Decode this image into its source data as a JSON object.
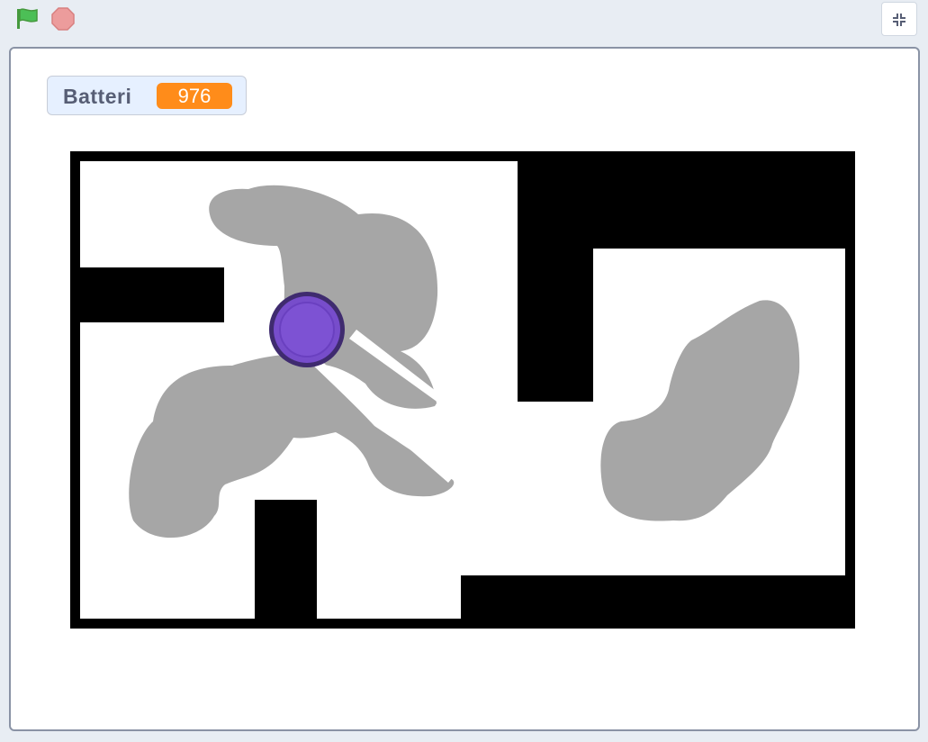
{
  "controls": {
    "green_flag_icon": "green-flag-icon",
    "stop_icon": "stop-sign-icon",
    "unfullscreen_icon": "unfullscreen-icon"
  },
  "monitor": {
    "label": "Batteri",
    "value": "976"
  },
  "colors": {
    "wall": "#000000",
    "floor": "#ffffff",
    "cleaned_dust": "#a6a6a6",
    "robot_fill": "#774dcb",
    "robot_outline": "#3f2b6f",
    "monitor_value_bg": "#ff8c1a",
    "green_flag": "#4cbf56",
    "stop": "#ec9c9c"
  }
}
